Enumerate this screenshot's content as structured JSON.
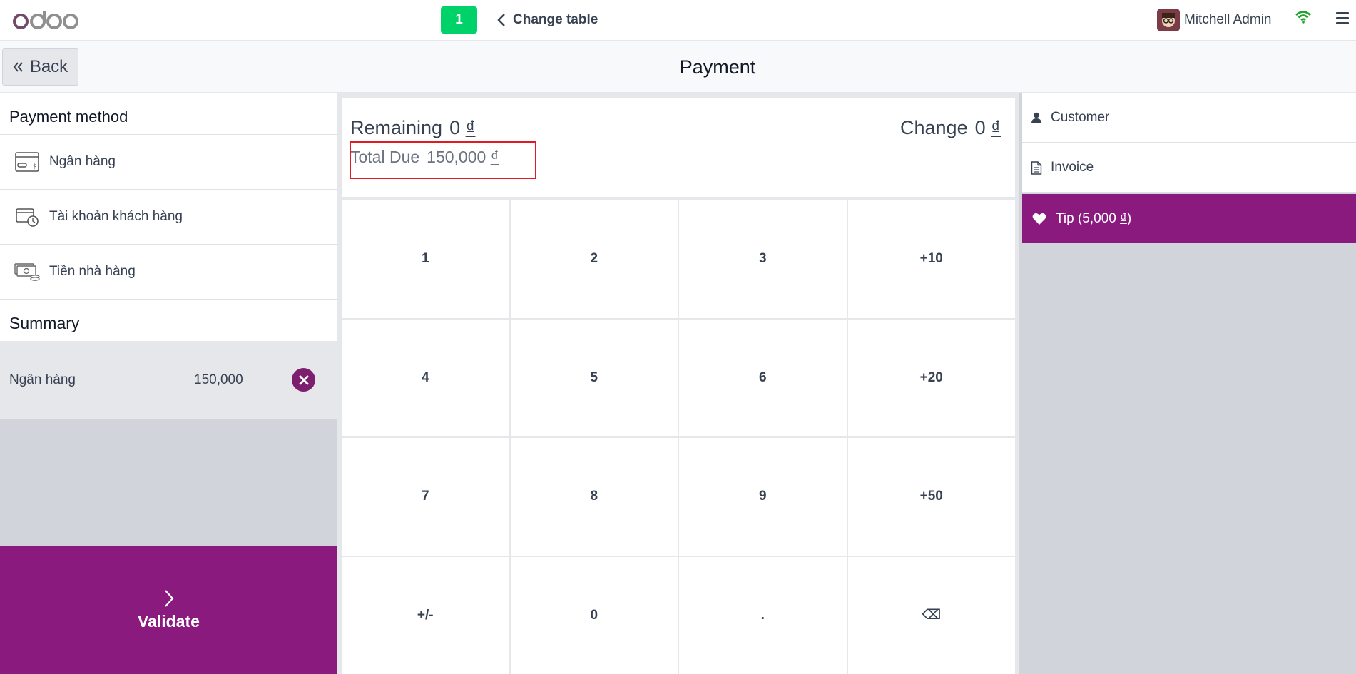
{
  "navbar": {
    "logo_text": "odoo",
    "table_number": "1",
    "change_table_label": "Change table",
    "user_name": "Mitchell Admin",
    "icons": {
      "wifi": "wifi-icon",
      "menu": "hamburger-menu-icon",
      "avatar": "user-avatar"
    }
  },
  "control": {
    "back_label": "Back",
    "title": "Payment"
  },
  "payment_methods": {
    "title": "Payment method",
    "items": [
      {
        "label": "Ngân hàng",
        "icon": "bank-card-icon"
      },
      {
        "label": "Tài khoản khách hàng",
        "icon": "customer-account-icon"
      },
      {
        "label": "Tiền nhà hàng",
        "icon": "cash-icon"
      }
    ]
  },
  "summary": {
    "title": "Summary",
    "lines": [
      {
        "name": "Ngân hàng",
        "amount": "150,000"
      }
    ]
  },
  "validate_label": "Validate",
  "status": {
    "remaining_label": "Remaining",
    "remaining_value": "0",
    "change_label": "Change",
    "change_value": "0",
    "total_due_label": "Total Due",
    "total_due_value": "150,000",
    "currency": "₫"
  },
  "numpad": {
    "keys": [
      "1",
      "2",
      "3",
      "+10",
      "4",
      "5",
      "6",
      "+20",
      "7",
      "8",
      "9",
      "+50",
      "+/-",
      "0",
      ".",
      "⌫"
    ]
  },
  "right_panel": {
    "customer_label": "Customer",
    "invoice_label": "Invoice",
    "tip_label": "Tip (5,000",
    "tip_currency": "₫",
    "tip_close": ")"
  },
  "colors": {
    "primary": "#8b1a7f",
    "table_badge": "#00d26a",
    "wifi": "#1fa32a",
    "highlight_border": "#e01b24"
  }
}
